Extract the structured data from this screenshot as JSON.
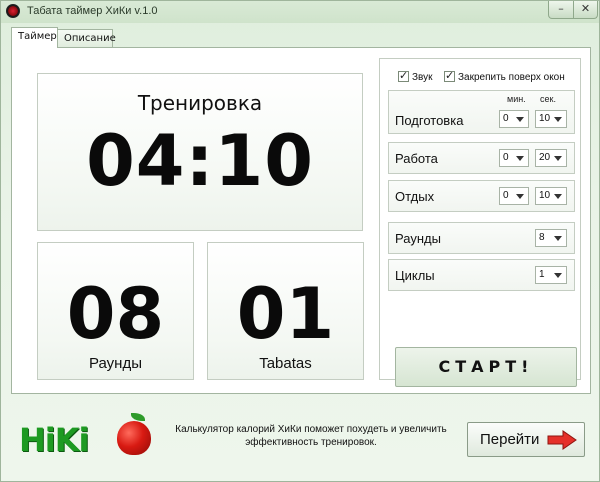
{
  "window": {
    "title": "Табата таймер ХиКи v.1.0",
    "min_glyph": "–",
    "close_glyph": "✕",
    "app_icon": "red-circle-icon"
  },
  "tabs": [
    {
      "label": "Таймер",
      "active": true
    },
    {
      "label": "Описание",
      "active": false
    }
  ],
  "display": {
    "stage": "Тренировка",
    "time": "04:10",
    "rounds_value": "08",
    "rounds_label": "Раунды",
    "tabatas_value": "01",
    "tabatas_label": "Tabatas"
  },
  "settings": {
    "sound_label": "Звук",
    "sound_checked": true,
    "ontop_label": "Закрепить поверх окон",
    "ontop_checked": true,
    "min_unit": "мин.",
    "sec_unit": "сек.",
    "prep": {
      "label": "Подготовка",
      "min": "0",
      "sec": "10"
    },
    "work": {
      "label": "Работа",
      "min": "0",
      "sec": "20"
    },
    "rest": {
      "label": "Отдых",
      "min": "0",
      "sec": "10"
    },
    "rounds": {
      "label": "Раунды",
      "value": "8"
    },
    "cycles": {
      "label": "Циклы",
      "value": "1"
    },
    "start_label": "СТАРТ!"
  },
  "footer": {
    "logo_text": "HiKi",
    "promo_line1": "Калькулятор калорий ХиКи поможет похудеть и увеличить",
    "promo_line2": "эффективность тренировок.",
    "go_label": "Перейти",
    "accent_red": "#e5302a",
    "logo_green": "#1d9a22"
  }
}
